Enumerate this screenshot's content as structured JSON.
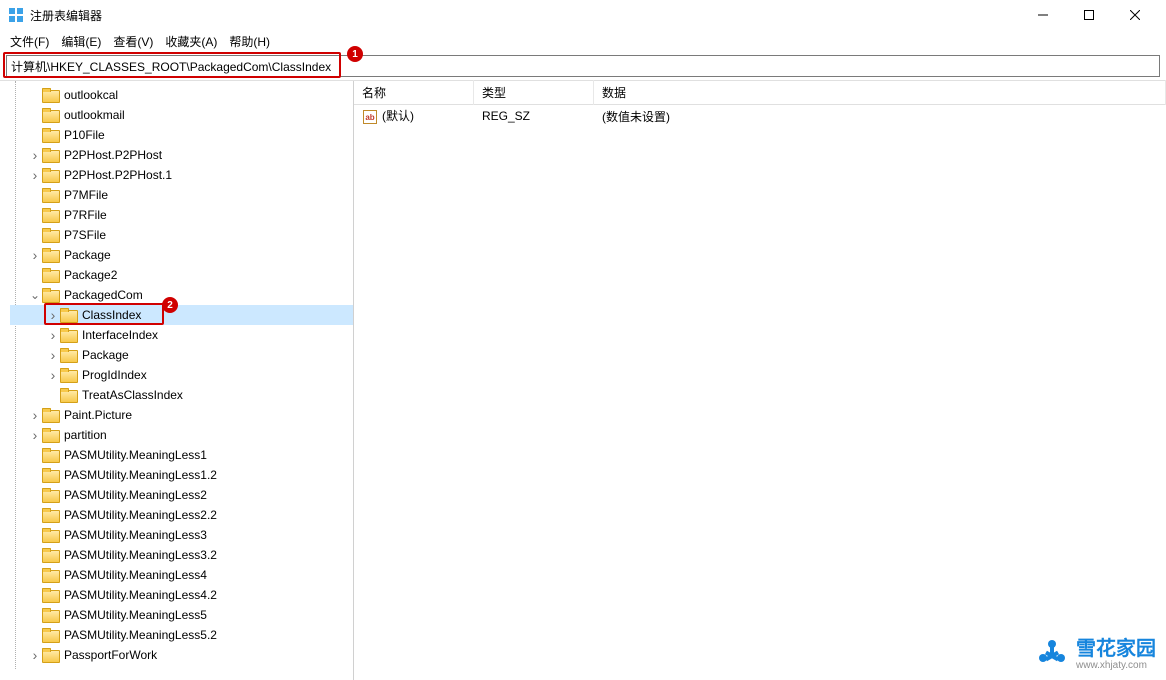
{
  "window": {
    "title": "注册表编辑器"
  },
  "menus": {
    "file": "文件(F)",
    "edit": "编辑(E)",
    "view": "查看(V)",
    "favorites": "收藏夹(A)",
    "help": "帮助(H)"
  },
  "address": {
    "path": "计算机\\HKEY_CLASSES_ROOT\\PackagedCom\\ClassIndex"
  },
  "annotations": {
    "badge1": "1",
    "badge2": "2"
  },
  "values_header": {
    "name": "名称",
    "type": "类型",
    "data": "数据"
  },
  "values_rows": [
    {
      "icon_text": "ab",
      "name": "(默认)",
      "type": "REG_SZ",
      "data": "(数值未设置)"
    }
  ],
  "tree": [
    {
      "indent": 1,
      "exp": "none",
      "label": "outlookcal"
    },
    {
      "indent": 1,
      "exp": "none",
      "label": "outlookmail"
    },
    {
      "indent": 1,
      "exp": "none",
      "label": "P10File"
    },
    {
      "indent": 1,
      "exp": "closed",
      "label": "P2PHost.P2PHost"
    },
    {
      "indent": 1,
      "exp": "closed",
      "label": "P2PHost.P2PHost.1"
    },
    {
      "indent": 1,
      "exp": "none",
      "label": "P7MFile"
    },
    {
      "indent": 1,
      "exp": "none",
      "label": "P7RFile"
    },
    {
      "indent": 1,
      "exp": "none",
      "label": "P7SFile"
    },
    {
      "indent": 1,
      "exp": "closed",
      "label": "Package"
    },
    {
      "indent": 1,
      "exp": "none",
      "label": "Package2"
    },
    {
      "indent": 1,
      "exp": "open",
      "label": "PackagedCom"
    },
    {
      "indent": 2,
      "exp": "closed",
      "label": "ClassIndex",
      "selected": true,
      "annotated": true
    },
    {
      "indent": 2,
      "exp": "closed",
      "label": "InterfaceIndex"
    },
    {
      "indent": 2,
      "exp": "closed",
      "label": "Package"
    },
    {
      "indent": 2,
      "exp": "closed",
      "label": "ProgIdIndex"
    },
    {
      "indent": 2,
      "exp": "none",
      "label": "TreatAsClassIndex"
    },
    {
      "indent": 1,
      "exp": "closed",
      "label": "Paint.Picture"
    },
    {
      "indent": 1,
      "exp": "closed",
      "label": "partition"
    },
    {
      "indent": 1,
      "exp": "none",
      "label": "PASMUtility.MeaningLess1"
    },
    {
      "indent": 1,
      "exp": "none",
      "label": "PASMUtility.MeaningLess1.2"
    },
    {
      "indent": 1,
      "exp": "none",
      "label": "PASMUtility.MeaningLess2"
    },
    {
      "indent": 1,
      "exp": "none",
      "label": "PASMUtility.MeaningLess2.2"
    },
    {
      "indent": 1,
      "exp": "none",
      "label": "PASMUtility.MeaningLess3"
    },
    {
      "indent": 1,
      "exp": "none",
      "label": "PASMUtility.MeaningLess3.2"
    },
    {
      "indent": 1,
      "exp": "none",
      "label": "PASMUtility.MeaningLess4"
    },
    {
      "indent": 1,
      "exp": "none",
      "label": "PASMUtility.MeaningLess4.2"
    },
    {
      "indent": 1,
      "exp": "none",
      "label": "PASMUtility.MeaningLess5"
    },
    {
      "indent": 1,
      "exp": "none",
      "label": "PASMUtility.MeaningLess5.2"
    },
    {
      "indent": 1,
      "exp": "closed",
      "label": "PassportForWork"
    }
  ],
  "watermark": {
    "main": "雪花家园",
    "sub": "www.xhjaty.com"
  }
}
